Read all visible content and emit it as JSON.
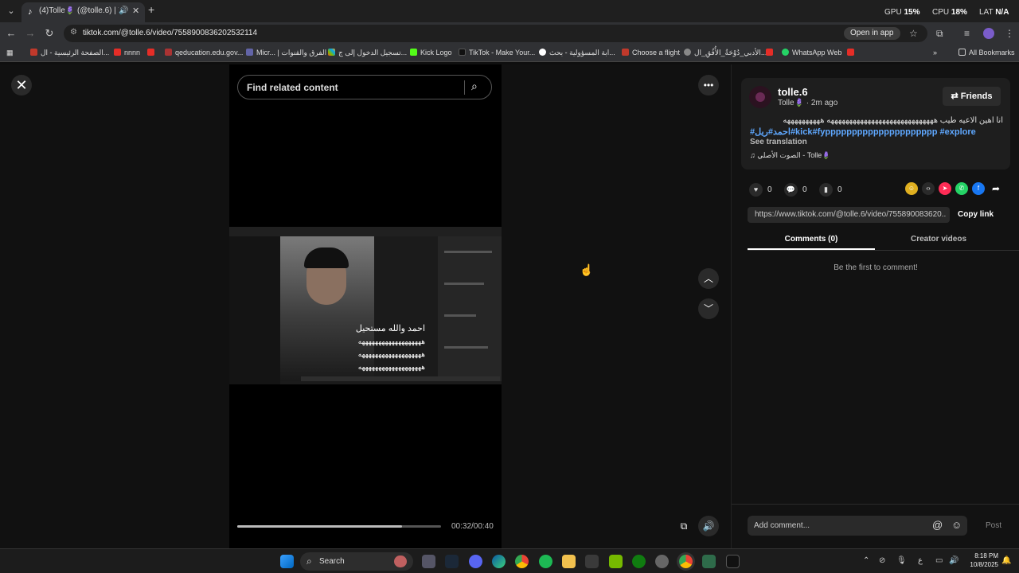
{
  "browser": {
    "tab_title": "(4)Tolle🪻 (@tolle.6) | TikTok",
    "new_tab": "+",
    "gpu_label": "GPU",
    "gpu_value": "15%",
    "cpu_label": "CPU",
    "cpu_value": "18%",
    "lat_label": "LAT",
    "lat_value": "N/A",
    "url": "tiktok.com/@tolle.6/video/7558900836202532114",
    "open_in_app": "Open in app",
    "bookmarks": [
      "الصفحة الرئيسية - ال...",
      "nnnn",
      "qeducation.edu.gov...",
      "Micr... | الفرق والقنوات",
      "تسجيل الدخول إلى ج...",
      "Kick Logo",
      "TikTok - Make Your...",
      "ابة المسؤولية - بحث...",
      "Choose a flight",
      "الأدبي_دُوْحَةُ_الأُفُقِ_ال...",
      "WhatsApp Web"
    ],
    "all_bookmarks": "All Bookmarks"
  },
  "video": {
    "search_placeholder": "Find related content",
    "overlay_line1": "احمد والله مستحيل",
    "overlay_line2": "هههههههههههههههههههه",
    "overlay_line3": "هههههههههههههههههههه",
    "overlay_line4": "هههههههههههههههههههه",
    "time": "00:32/00:40",
    "progress_fraction": 0.81
  },
  "panel": {
    "username": "tolle.6",
    "subline": "Tolle🪻 · 2m ago",
    "friends_label": "Friends",
    "caption": "انا اهين الاعيه طيب هههههههههههههههههههههههههههههه ههههههههههه",
    "hashtags": "#احمد#ريل#kick#fyppppppppppppppppppppp #explore",
    "see_translation": "See translation",
    "music": "الصوت الأصلي - Tolle🪻",
    "likes": "0",
    "comments": "0",
    "saves": "0",
    "link": "https://www.tiktok.com/@tolle.6/video/755890083620...",
    "copy_link": "Copy link",
    "tab_comments": "Comments (0)",
    "tab_creator": "Creator videos",
    "first_comment": "Be the first to comment!",
    "add_comment": "Add comment...",
    "post": "Post"
  },
  "taskbar": {
    "search_label": "Search",
    "time": "8:18 PM",
    "date": "10/8/2025",
    "lang": "ع"
  },
  "colors": {
    "hashtag": "#5fa8ff",
    "background": "#111111",
    "panel": "#121212"
  }
}
